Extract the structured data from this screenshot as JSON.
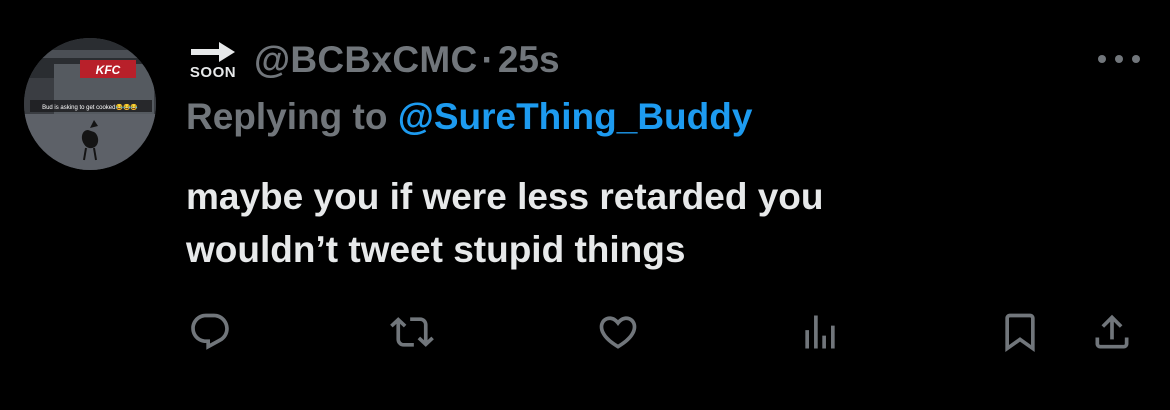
{
  "tweet": {
    "avatar": {
      "sign_text": "KFC",
      "caption": "Bud is asking to get cooked😂😂😂"
    },
    "badge_text": "SOON",
    "handle": "@BCBxCMC",
    "separator": "·",
    "time": "25s",
    "replying_prefix": "Replying to ",
    "replying_handle": "@SureThing_Buddy",
    "text_line1": "maybe you if were less retarded you",
    "text_line2": "wouldn’t tweet stupid things"
  },
  "actions": {
    "icons": [
      "reply-icon",
      "retweet-icon",
      "like-icon",
      "views-icon",
      "bookmark-icon",
      "share-icon"
    ]
  },
  "colors": {
    "background": "#000000",
    "primary_text": "#e7e9ea",
    "secondary_text": "#71767b",
    "link": "#1d9bf0"
  }
}
